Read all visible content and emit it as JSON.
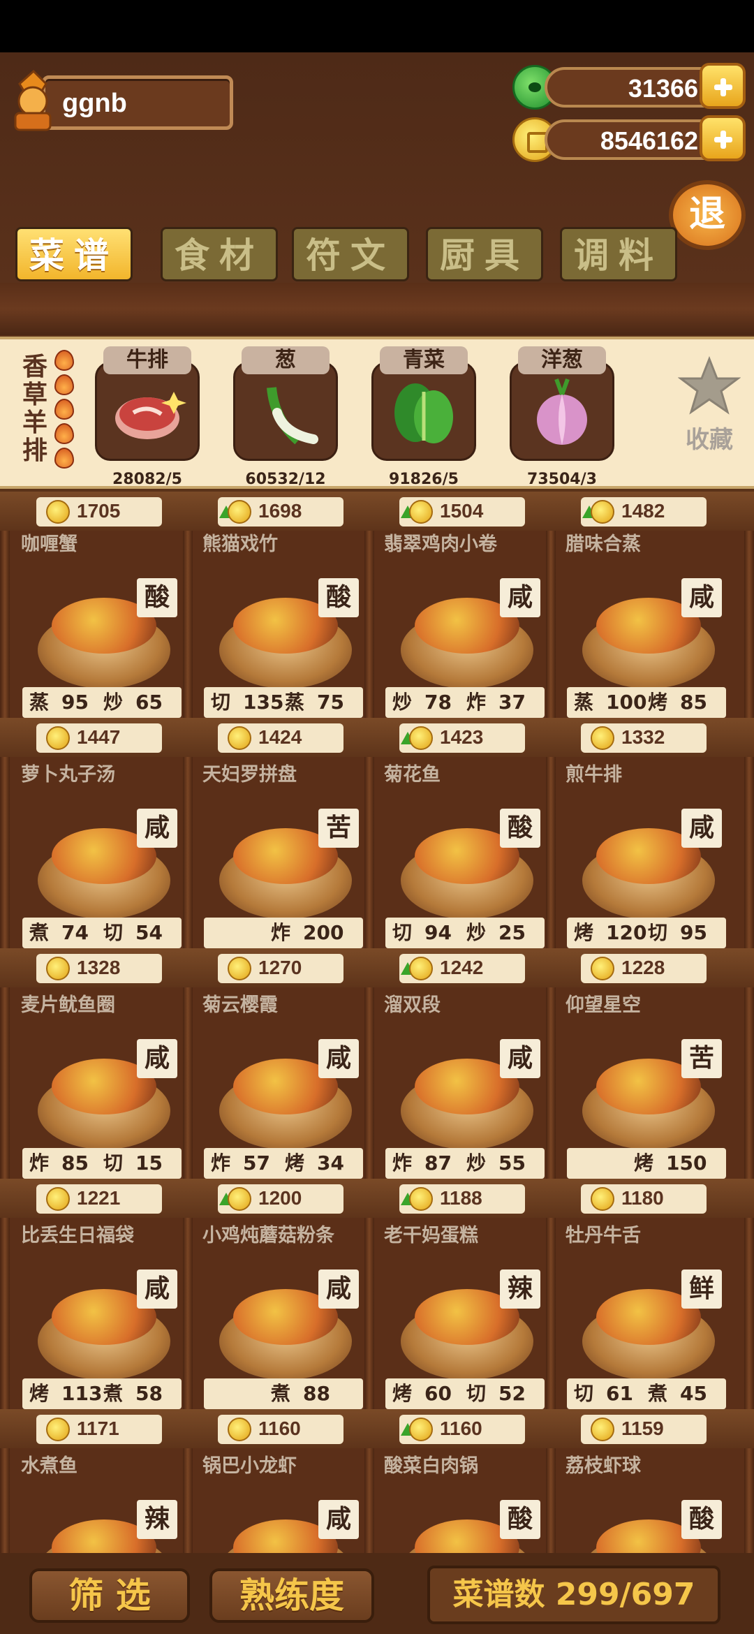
{
  "player": {
    "name": "ggnb"
  },
  "currency": {
    "jade": "31366",
    "coins": "8546162"
  },
  "exit_label": "退",
  "tabs": [
    "菜谱",
    "食材",
    "符文",
    "厨具",
    "调料"
  ],
  "selected_dish": {
    "name": "香草羊排",
    "flames": 5
  },
  "ingredients": [
    {
      "name": "牛排",
      "count": "28082/5",
      "icon": "steak-icon"
    },
    {
      "name": "葱",
      "count": "60532/12",
      "icon": "scallion-icon"
    },
    {
      "name": "青菜",
      "count": "91826/5",
      "icon": "greens-icon"
    },
    {
      "name": "洋葱",
      "count": "73504/3",
      "icon": "onion-icon"
    }
  ],
  "favorite_label": "收藏",
  "top_prices": [
    {
      "v": "1705",
      "up": false
    },
    {
      "v": "1698",
      "up": true
    },
    {
      "v": "1504",
      "up": true
    },
    {
      "v": "1482",
      "up": true
    }
  ],
  "rows": [
    {
      "dishes": [
        {
          "name": "咖喱蟹",
          "flavor": "酸",
          "skills": [
            [
              "蒸",
              "95"
            ],
            [
              "炒",
              "65"
            ]
          ]
        },
        {
          "name": "熊猫戏竹",
          "flavor": "酸",
          "skills": [
            [
              "切",
              "135"
            ],
            [
              "蒸",
              "75"
            ]
          ]
        },
        {
          "name": "翡翠鸡肉小卷",
          "flavor": "咸",
          "skills": [
            [
              "炒",
              "78"
            ],
            [
              "炸",
              "37"
            ]
          ]
        },
        {
          "name": "腊味合蒸",
          "flavor": "咸",
          "skills": [
            [
              "蒸",
              "100"
            ],
            [
              "烤",
              "85"
            ]
          ]
        }
      ],
      "prices": [
        {
          "v": "1447",
          "up": false
        },
        {
          "v": "1424",
          "up": false
        },
        {
          "v": "1423",
          "up": true
        },
        {
          "v": "1332",
          "up": false
        }
      ]
    },
    {
      "dishes": [
        {
          "name": "萝卜丸子汤",
          "flavor": "咸",
          "skills": [
            [
              "煮",
              "74"
            ],
            [
              "切",
              "54"
            ]
          ]
        },
        {
          "name": "天妇罗拼盘",
          "flavor": "苦",
          "skills": [
            [
              "炸",
              "200"
            ]
          ]
        },
        {
          "name": "菊花鱼",
          "flavor": "酸",
          "skills": [
            [
              "切",
              "94"
            ],
            [
              "炒",
              "25"
            ]
          ]
        },
        {
          "name": "煎牛排",
          "flavor": "咸",
          "skills": [
            [
              "烤",
              "120"
            ],
            [
              "切",
              "95"
            ]
          ]
        }
      ],
      "prices": [
        {
          "v": "1328",
          "up": false
        },
        {
          "v": "1270",
          "up": false
        },
        {
          "v": "1242",
          "up": true
        },
        {
          "v": "1228",
          "up": false
        }
      ]
    },
    {
      "dishes": [
        {
          "name": "麦片鱿鱼圈",
          "flavor": "咸",
          "skills": [
            [
              "炸",
              "85"
            ],
            [
              "切",
              "15"
            ]
          ]
        },
        {
          "name": "菊云樱霞",
          "flavor": "咸",
          "skills": [
            [
              "炸",
              "57"
            ],
            [
              "烤",
              "34"
            ]
          ]
        },
        {
          "name": "溜双段",
          "flavor": "咸",
          "skills": [
            [
              "炸",
              "87"
            ],
            [
              "炒",
              "55"
            ]
          ]
        },
        {
          "name": "仰望星空",
          "flavor": "苦",
          "skills": [
            [
              "烤",
              "150"
            ]
          ]
        }
      ],
      "prices": [
        {
          "v": "1221",
          "up": false
        },
        {
          "v": "1200",
          "up": true
        },
        {
          "v": "1188",
          "up": true
        },
        {
          "v": "1180",
          "up": false
        }
      ]
    },
    {
      "dishes": [
        {
          "name": "比丢生日福袋",
          "flavor": "咸",
          "skills": [
            [
              "烤",
              "113"
            ],
            [
              "煮",
              "58"
            ]
          ]
        },
        {
          "name": "小鸡炖蘑菇粉条",
          "flavor": "咸",
          "skills": [
            [
              "煮",
              "88"
            ]
          ]
        },
        {
          "name": "老干妈蛋糕",
          "flavor": "辣",
          "skills": [
            [
              "烤",
              "60"
            ],
            [
              "切",
              "52"
            ]
          ]
        },
        {
          "name": "牡丹牛舌",
          "flavor": "鲜",
          "skills": [
            [
              "切",
              "61"
            ],
            [
              "煮",
              "45"
            ]
          ]
        }
      ],
      "prices": [
        {
          "v": "1171",
          "up": false
        },
        {
          "v": "1160",
          "up": false
        },
        {
          "v": "1160",
          "up": true
        },
        {
          "v": "1159",
          "up": false
        }
      ]
    },
    {
      "dishes": [
        {
          "name": "水煮鱼",
          "flavor": "辣",
          "skills": []
        },
        {
          "name": "锅巴小龙虾",
          "flavor": "咸",
          "skills": []
        },
        {
          "name": "酸菜白肉锅",
          "flavor": "酸",
          "skills": []
        },
        {
          "name": "荔枝虾球",
          "flavor": "酸",
          "skills": []
        }
      ],
      "prices": []
    }
  ],
  "bottom": {
    "filter": "筛 选",
    "proficiency": "熟练度",
    "recipe_count": "菜谱数 299/697"
  }
}
